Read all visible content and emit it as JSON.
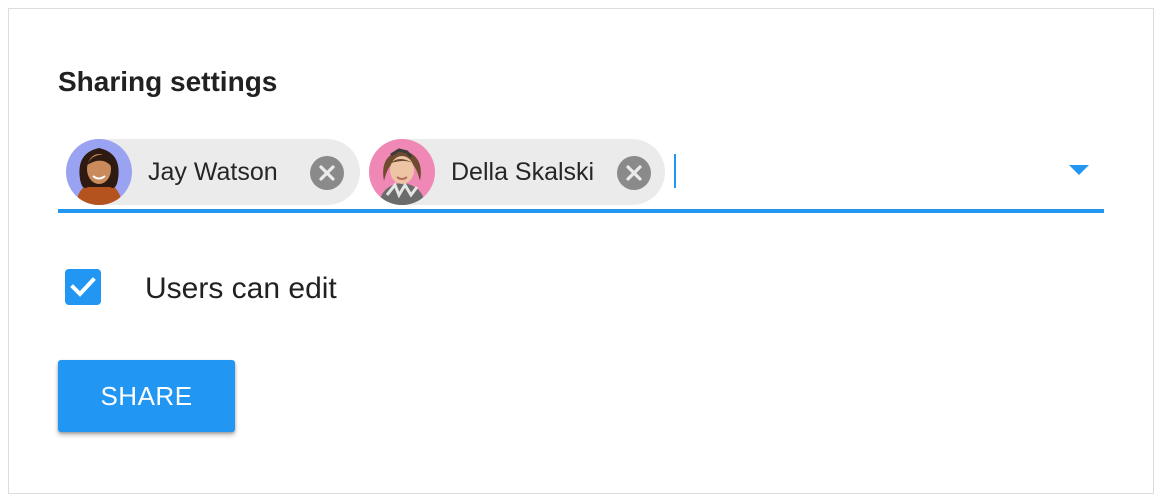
{
  "title": "Sharing settings",
  "chips": [
    {
      "name": "Jay Watson",
      "avatar_bg": "#9aa3f2"
    },
    {
      "name": "Della Skalski",
      "avatar_bg": "#f088b6"
    }
  ],
  "input": {
    "value": ""
  },
  "checkbox": {
    "label": "Users can edit",
    "checked": true
  },
  "share_button": {
    "label": "SHARE"
  },
  "colors": {
    "accent": "#2196F3",
    "chip_bg": "#ebebeb",
    "remove_icon": "#8a8a8a"
  },
  "icons": [
    "close-circle-icon",
    "dropdown-arrow-icon",
    "check-icon"
  ]
}
